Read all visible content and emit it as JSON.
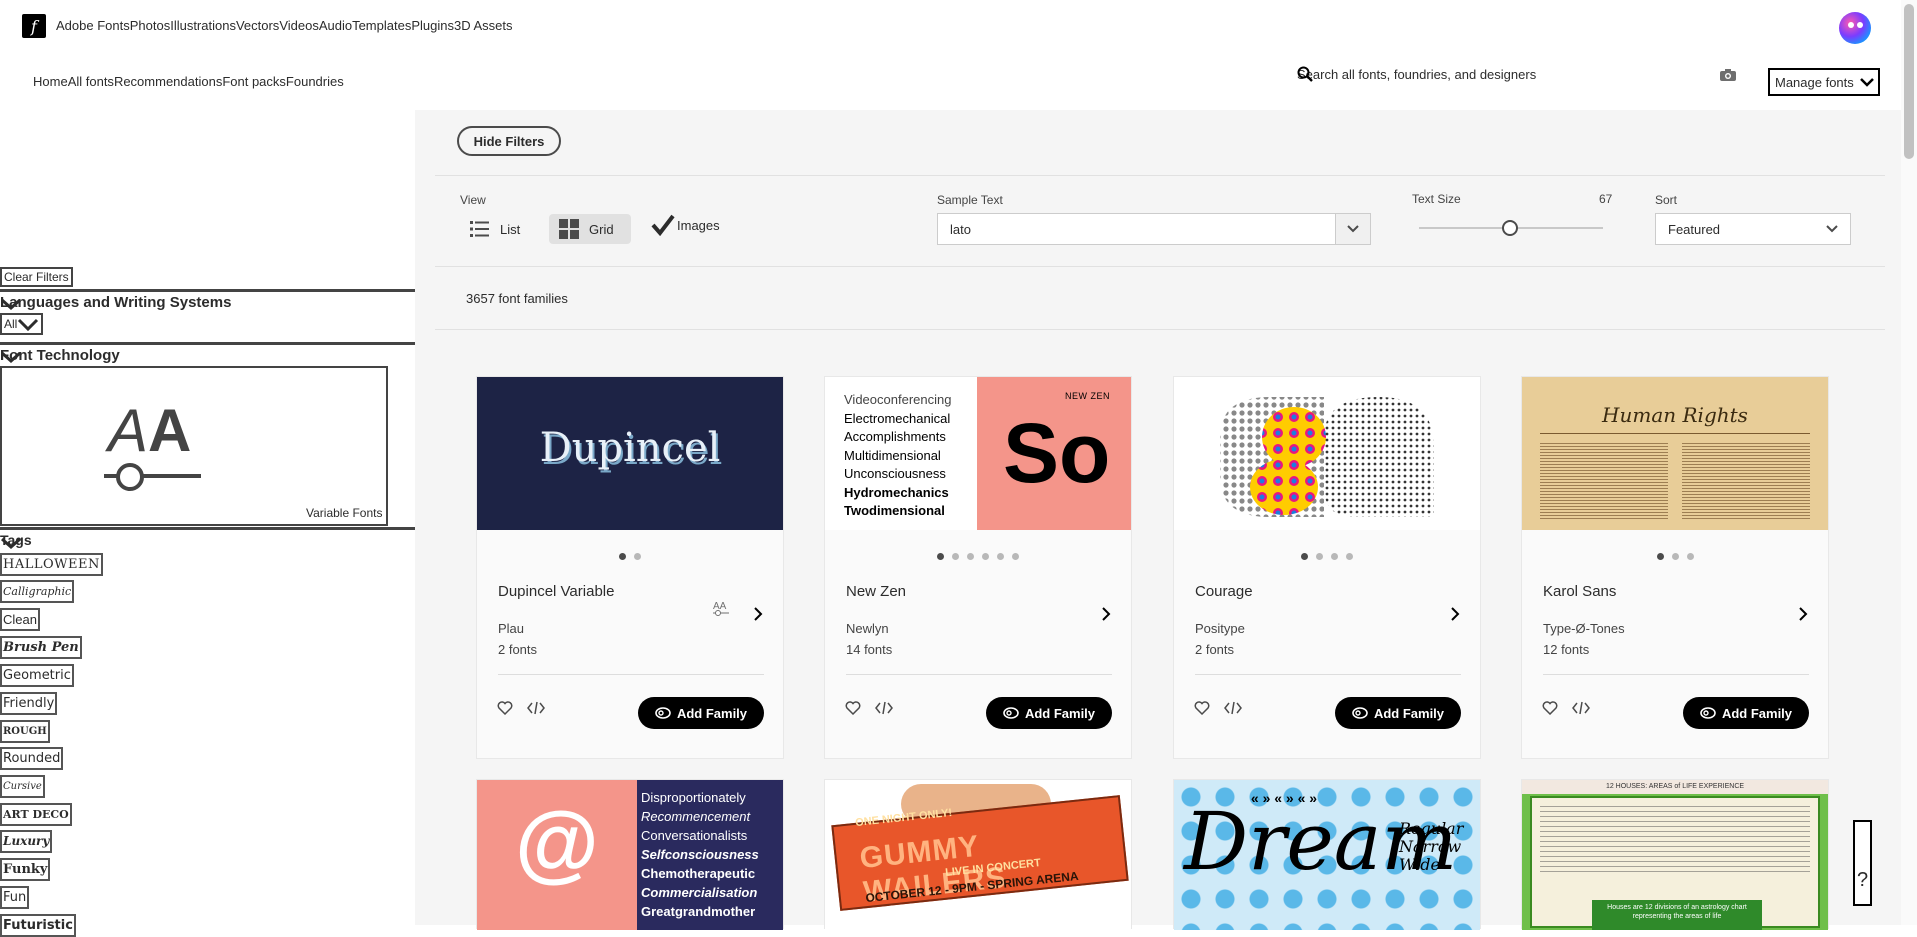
{
  "topbar": {
    "logo": "f",
    "nav": [
      "Adobe Fonts",
      "Photos",
      "Illustrations",
      "Vectors",
      "Videos",
      "Audio",
      "Templates",
      "Plugins",
      "3D Assets"
    ]
  },
  "subnav": [
    "Home",
    "All fonts",
    "Recommendations",
    "Font packs",
    "Foundries"
  ],
  "search": {
    "placeholder": "Search all fonts, foundries, and designers"
  },
  "manage_fonts": "Manage fonts",
  "sidebar": {
    "clear_filters": "Clear Filters",
    "languages_title": "Languages and Writing Systems",
    "languages_value": "All",
    "font_tech_title": "Font Technology",
    "variable_fonts": "Variable Fonts",
    "tags_title": "Tags",
    "tags": [
      "HALLOWEEN",
      "Calligraphic",
      "Clean",
      "Brush Pen",
      "Geometric",
      "Friendly",
      "ROUGH",
      "Rounded",
      "Cursive",
      "ART DECO",
      "Luxury",
      "Funky",
      "Fun",
      "Futuristic"
    ]
  },
  "toolbar": {
    "hide_filters": "Hide Filters",
    "view_label": "View",
    "view_list": "List",
    "view_grid": "Grid",
    "images": "Images",
    "sample_label": "Sample Text",
    "sample_value": "lato",
    "size_label": "Text Size",
    "size_value": "67",
    "sort_label": "Sort",
    "sort_value": "Featured"
  },
  "count": "3657 font families",
  "cards": [
    {
      "name": "Dupincel Variable",
      "foundry": "Plau",
      "fonts": "2 fonts",
      "dots": 2,
      "active": 0,
      "variable": true,
      "add": "Add Family"
    },
    {
      "name": "New Zen",
      "foundry": "Newlyn",
      "fonts": "14 fonts",
      "dots": 6,
      "active": 0,
      "variable": false,
      "add": "Add Family"
    },
    {
      "name": "Courage",
      "foundry": "Positype",
      "fonts": "2 fonts",
      "dots": 4,
      "active": 0,
      "variable": false,
      "add": "Add Family"
    },
    {
      "name": "Karol Sans",
      "foundry": "Type-Ø-Tones",
      "fonts": "12 fonts",
      "dots": 3,
      "active": 0,
      "variable": false,
      "add": "Add Family"
    }
  ],
  "previews": {
    "dupincel": "Dupincel",
    "newzen_words": [
      "Videoconferencing",
      "Electromechanical",
      "Accomplishments",
      "Multidimensional",
      "Unconsciousness",
      "Hydromechanics",
      "Twodimensional"
    ],
    "newzen_tag": "NEW ZEN",
    "newzen_big": "So",
    "karol_title": "Human Rights",
    "row2_words": [
      "Disproportionately",
      "Recommencement",
      "Conversationalists",
      "Selfconsciousness",
      "Chemotherapeutic",
      "Commercialisation",
      "Greatgrandmother"
    ],
    "gummy_top": "ONE NIGHT ONLY!",
    "gummy_main": "GUMMY WAILERS",
    "gummy_sub": "LIVE IN CONCERT",
    "gummy_date": "OCTOBER 12 - 9PM - SPRING ARENA",
    "dream": "Dream",
    "dream_side": [
      "Regular",
      "Narrow",
      "Wide"
    ],
    "houses_title": "12 HOUSES: AREAS of LIFE EXPERIENCE",
    "houses_center": "Houses are 12 divisions of an astrology chart representing the areas of life"
  },
  "help": "?"
}
